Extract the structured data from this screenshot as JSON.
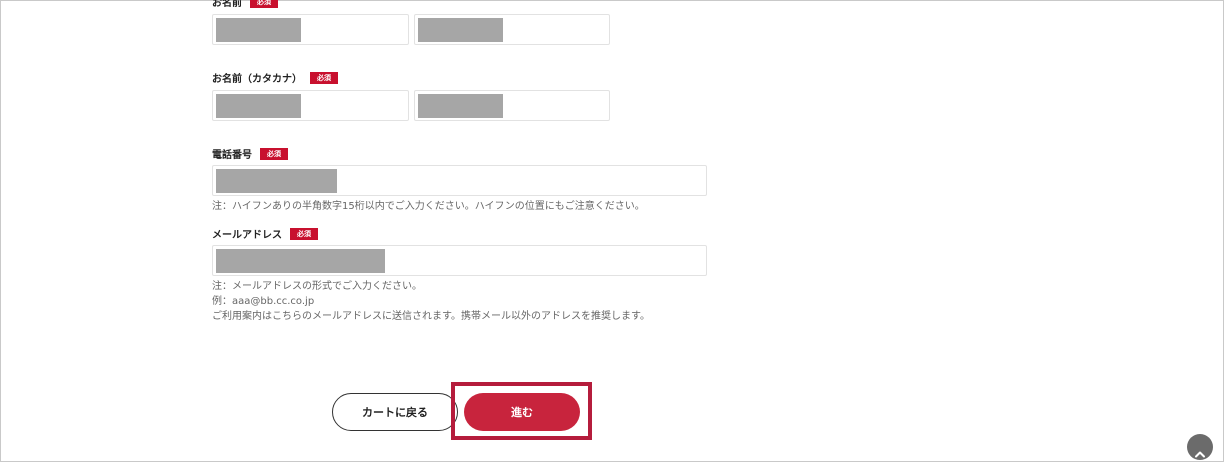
{
  "form": {
    "required_badge": "必須",
    "name": {
      "label": "お名前"
    },
    "name_kana": {
      "label": "お名前（カタカナ）"
    },
    "phone": {
      "label": "電話番号",
      "note": "注：ハイフンありの半角数字15桁以内でご入力ください。ハイフンの位置にもご注意ください。"
    },
    "email": {
      "label": "メールアドレス",
      "notes": [
        "注：メールアドレスの形式でご入力ください。",
        "例：aaa@bb.cc.co.jp",
        "ご利用案内はこちらのメールアドレスに送信されます。携帯メール以外のアドレスを推奨します。"
      ]
    }
  },
  "buttons": {
    "back_label": "カートに戻る",
    "next_label": "進む"
  },
  "icons": {
    "scroll_top": "chevron-up-icon"
  },
  "colors": {
    "accent": "#c8243d",
    "required_badge": "#c8102e",
    "highlight_border": "#b51c3c",
    "masked_input": "#a6a6a6"
  }
}
